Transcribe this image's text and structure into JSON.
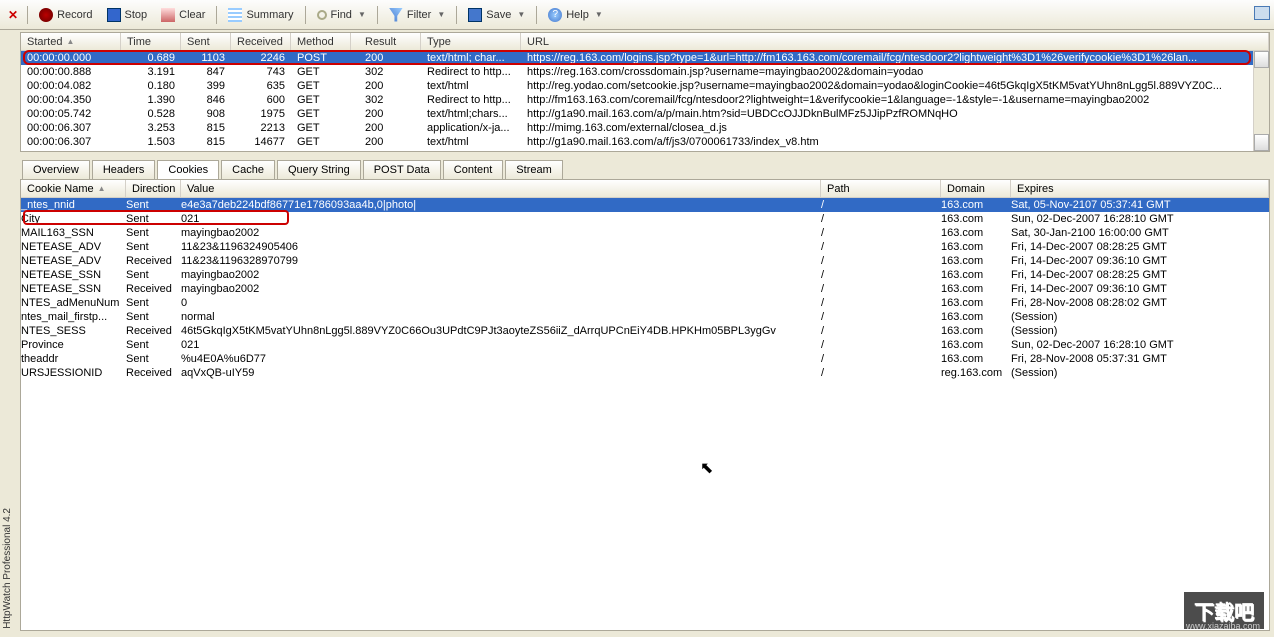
{
  "toolbar": {
    "record": "Record",
    "stop": "Stop",
    "clear": "Clear",
    "summary": "Summary",
    "find": "Find",
    "filter": "Filter",
    "save": "Save",
    "help": "Help"
  },
  "topGrid": {
    "headers": {
      "started": "Started",
      "time": "Time",
      "sent": "Sent",
      "received": "Received",
      "method": "Method",
      "result": "Result",
      "type": "Type",
      "url": "URL"
    },
    "rows": [
      {
        "started": "00:00:00.000",
        "time": "0.689",
        "sent": "1103",
        "received": "2246",
        "method": "POST",
        "result": "200",
        "type": "text/html; char...",
        "url": "https://reg.163.com/logins.jsp?type=1&url=http://fm163.163.com/coremail/fcg/ntesdoor2?lightweight%3D1%26verifycookie%3D1%26lan...",
        "sel": true
      },
      {
        "started": "00:00:00.888",
        "time": "3.191",
        "sent": "847",
        "received": "743",
        "method": "GET",
        "result": "302",
        "type": "Redirect to http...",
        "url": "https://reg.163.com/crossdomain.jsp?username=mayingbao2002&domain=yodao"
      },
      {
        "started": "00:00:04.082",
        "time": "0.180",
        "sent": "399",
        "received": "635",
        "method": "GET",
        "result": "200",
        "type": "text/html",
        "url": "http://reg.yodao.com/setcookie.jsp?username=mayingbao2002&domain=yodao&loginCookie=46t5GkqIgX5tKM5vatYUhn8nLgg5l.889VYZ0C..."
      },
      {
        "started": "00:00:04.350",
        "time": "1.390",
        "sent": "846",
        "received": "600",
        "method": "GET",
        "result": "302",
        "type": "Redirect to http...",
        "url": "http://fm163.163.com/coremail/fcg/ntesdoor2?lightweight=1&verifycookie=1&language=-1&style=-1&username=mayingbao2002"
      },
      {
        "started": "00:00:05.742",
        "time": "0.528",
        "sent": "908",
        "received": "1975",
        "method": "GET",
        "result": "200",
        "type": "text/html;chars...",
        "url": "http://g1a90.mail.163.com/a/p/main.htm?sid=UBDCcOJJDknBulMFz5JJipPzfROMNqHO"
      },
      {
        "started": "00:00:06.307",
        "time": "3.253",
        "sent": "815",
        "received": "2213",
        "method": "GET",
        "result": "200",
        "type": "application/x-ja...",
        "url": "http://mimg.163.com/external/closea_d.js"
      },
      {
        "started": "00:00:06.307",
        "time": "1.503",
        "sent": "815",
        "received": "14677",
        "method": "GET",
        "result": "200",
        "type": "text/html",
        "url": "http://g1a90.mail.163.com/a/f/js3/0700061733/index_v8.htm"
      }
    ]
  },
  "tabs": [
    "Overview",
    "Headers",
    "Cookies",
    "Cache",
    "Query String",
    "POST Data",
    "Content",
    "Stream"
  ],
  "activeTab": "Cookies",
  "cookieGrid": {
    "headers": {
      "name": "Cookie Name",
      "dir": "Direction",
      "value": "Value",
      "path": "Path",
      "domain": "Domain",
      "expires": "Expires"
    },
    "rows": [
      {
        "name": "_ntes_nnid",
        "dir": "Sent",
        "value": "e4e3a7deb224bdf86771e1786093aa4b,0|photo|",
        "path": "/",
        "domain": "163.com",
        "expires": "Sat, 05-Nov-2107 05:37:41 GMT",
        "sel": true
      },
      {
        "name": "City",
        "dir": "Sent",
        "value": "021",
        "path": "/",
        "domain": "163.com",
        "expires": "Sun, 02-Dec-2007 16:28:10 GMT",
        "red": true
      },
      {
        "name": "MAIL163_SSN",
        "dir": "Sent",
        "value": "mayingbao2002",
        "path": "/",
        "domain": "163.com",
        "expires": "Sat, 30-Jan-2100 16:00:00 GMT"
      },
      {
        "name": "NETEASE_ADV",
        "dir": "Sent",
        "value": "11&23&1196324905406",
        "path": "/",
        "domain": "163.com",
        "expires": "Fri, 14-Dec-2007 08:28:25 GMT"
      },
      {
        "name": "NETEASE_ADV",
        "dir": "Received",
        "value": "11&23&1196328970799",
        "path": "/",
        "domain": "163.com",
        "expires": "Fri, 14-Dec-2007 09:36:10 GMT"
      },
      {
        "name": "NETEASE_SSN",
        "dir": "Sent",
        "value": "mayingbao2002",
        "path": "/",
        "domain": "163.com",
        "expires": "Fri, 14-Dec-2007 08:28:25 GMT"
      },
      {
        "name": "NETEASE_SSN",
        "dir": "Received",
        "value": "mayingbao2002",
        "path": "/",
        "domain": "163.com",
        "expires": "Fri, 14-Dec-2007 09:36:10 GMT"
      },
      {
        "name": "NTES_adMenuNum",
        "dir": "Sent",
        "value": "0",
        "path": "/",
        "domain": "163.com",
        "expires": "Fri, 28-Nov-2008 08:28:02 GMT"
      },
      {
        "name": "ntes_mail_firstp...",
        "dir": "Sent",
        "value": "normal",
        "path": "/",
        "domain": "163.com",
        "expires": "(Session)"
      },
      {
        "name": "NTES_SESS",
        "dir": "Received",
        "value": "46t5GkqIgX5tKM5vatYUhn8nLgg5l.889VYZ0C66Ou3UPdtC9PJt3aoyteZS56iiZ_dArrqUPCnEiY4DB.HPKHm05BPL3ygGv",
        "path": "/",
        "domain": "163.com",
        "expires": "(Session)"
      },
      {
        "name": "Province",
        "dir": "Sent",
        "value": "021",
        "path": "/",
        "domain": "163.com",
        "expires": "Sun, 02-Dec-2007 16:28:10 GMT"
      },
      {
        "name": "theaddr",
        "dir": "Sent",
        "value": "%u4E0A%u6D77",
        "path": "/",
        "domain": "163.com",
        "expires": "Fri, 28-Nov-2008 05:37:31 GMT"
      },
      {
        "name": "URSJESSIONID",
        "dir": "Received",
        "value": "aqVxQB-uIY59",
        "path": "/",
        "domain": "reg.163.com",
        "expires": "(Session)"
      }
    ]
  },
  "sideLabel": "HttpWatch Professional 4.2",
  "watermark": "下载吧",
  "watermarkSub": "www.xiazaiba.com"
}
